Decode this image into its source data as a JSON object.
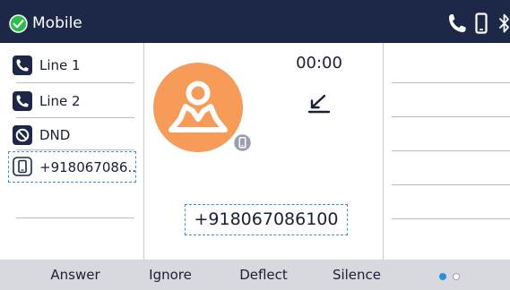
{
  "title_bar": {
    "title": "Mobile",
    "check_icon": "check-circle-icon",
    "status_icons": [
      "phone-handset-icon",
      "mobile-phone-icon",
      "bluetooth-icon"
    ]
  },
  "line_keys": [
    {
      "label": "Line 1",
      "icon": "phone-handset-icon"
    },
    {
      "label": "Line 2",
      "icon": "phone-handset-icon"
    },
    {
      "label": "DND",
      "icon": "do-not-disturb-icon"
    }
  ],
  "selected_key": {
    "label": "+918067086..",
    "icon": "mobile-phone-icon"
  },
  "call": {
    "timer": "00:00",
    "direction_icon": "incoming-arrow-icon",
    "number": "+918067086100",
    "avatar_icon": "contact-avatar-icon",
    "badge_icon": "mobile-badge-icon"
  },
  "softkeys": [
    "Answer",
    "Ignore",
    "Deflect",
    "Silence"
  ],
  "pagination": {
    "total": 2,
    "current": 1
  },
  "colors": {
    "title_bar": "#1d2849",
    "check_green": "#2dbd4a",
    "avatar_orange": "#f79b58",
    "softkey_bar": "#d7d9df",
    "focus_blue": "#3a8fd8"
  }
}
